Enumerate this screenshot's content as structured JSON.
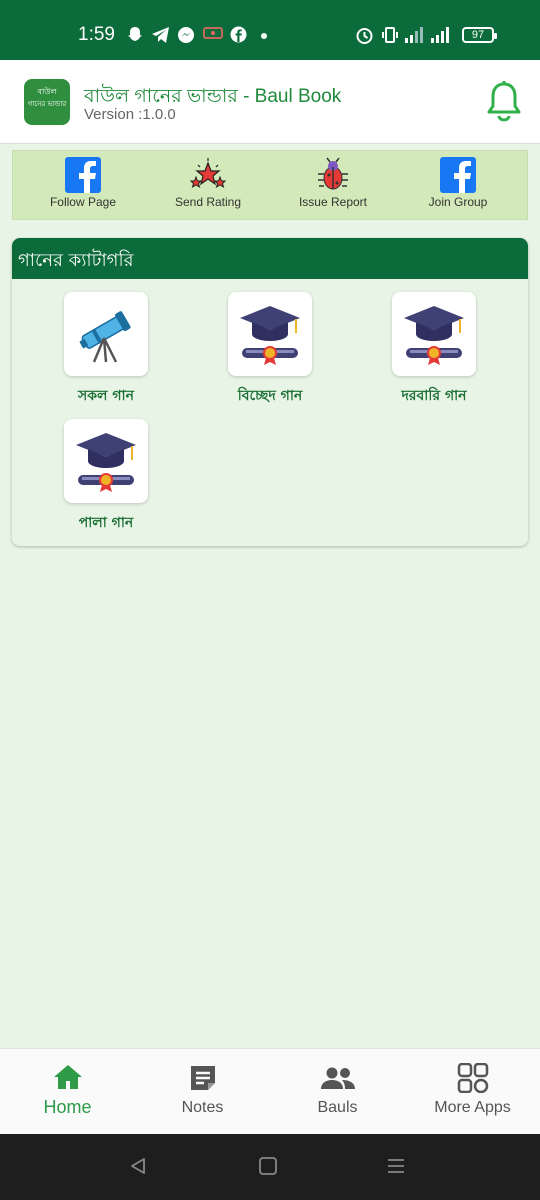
{
  "status_bar": {
    "time": "1:59",
    "battery": "97"
  },
  "header": {
    "title": "বাউল গানের ভান্ডার - Baul Book",
    "version": "Version :1.0.0",
    "logo_line1": "বাউল",
    "logo_line2": "গানের ভান্ডার"
  },
  "actions": [
    {
      "label": "Follow Page",
      "icon": "facebook-icon"
    },
    {
      "label": "Send Rating",
      "icon": "stars-icon"
    },
    {
      "label": "Issue Report",
      "icon": "bug-icon"
    },
    {
      "label": "Join Group",
      "icon": "facebook-icon"
    }
  ],
  "categories": {
    "title": "গানের ক্যাটাগরি",
    "items": [
      {
        "label": "সকল গান",
        "icon": "telescope-icon"
      },
      {
        "label": "বিচ্ছেদ গান",
        "icon": "graduation-cap-icon"
      },
      {
        "label": "দরবারি গান",
        "icon": "graduation-cap-icon"
      },
      {
        "label": "পালা গান",
        "icon": "graduation-cap-icon"
      }
    ]
  },
  "bottom_nav": [
    {
      "label": "Home",
      "icon": "home-icon",
      "active": true
    },
    {
      "label": "Notes",
      "icon": "notes-icon",
      "active": false
    },
    {
      "label": "Bauls",
      "icon": "people-icon",
      "active": false
    },
    {
      "label": "More Apps",
      "icon": "apps-grid-icon",
      "active": false
    }
  ],
  "colors": {
    "primary": "#0b6b3a",
    "accent": "#2f9a48",
    "background": "#e8f5e6",
    "panel": "#d3e9b9"
  }
}
